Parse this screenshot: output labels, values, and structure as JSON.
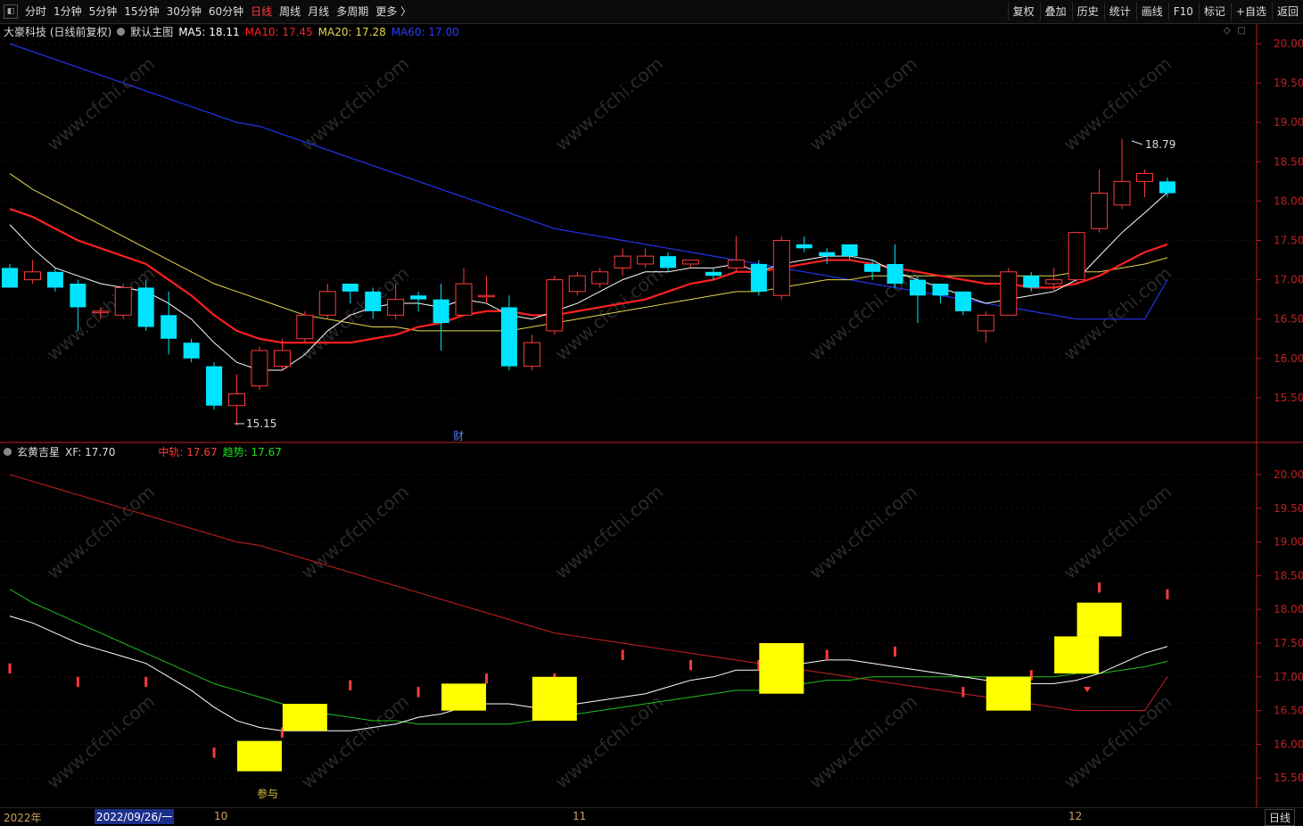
{
  "toolbar": {
    "periods": [
      "分时",
      "1分钟",
      "5分钟",
      "15分钟",
      "30分钟",
      "60分钟",
      "日线",
      "周线",
      "月线",
      "多周期",
      "更多 〉"
    ],
    "active_index": 6,
    "right_buttons": [
      "复权",
      "叠加",
      "历史",
      "统计",
      "画线",
      "F10",
      "标记",
      "+自选",
      "返回"
    ]
  },
  "main_legend": {
    "stock": "大豪科技 (日线前复权)",
    "indicator": "默认主图",
    "ma5": "MA5: 18.11",
    "ma10": "MA10: 17.45",
    "ma20": "MA20: 17.28",
    "ma60": "MA60: 17.00"
  },
  "sub_legend": {
    "name": "玄黄吉星",
    "xf": "XF: 17.70",
    "zg": "中轨: 17.67",
    "qs": "趋势: 17.67"
  },
  "annotations": {
    "high": "18.79",
    "low": "15.15",
    "cai": "财",
    "canyu": "参与"
  },
  "watermark": "www.cfchi.com",
  "main_axis": [
    "20.00",
    "19.50",
    "19.00",
    "18.50",
    "18.00",
    "17.50",
    "17.00",
    "16.50",
    "16.00",
    "15.50"
  ],
  "sub_axis": [
    "20.00",
    "19.50",
    "19.00",
    "18.50",
    "18.00",
    "17.50",
    "17.00",
    "16.50",
    "16.00",
    "15.50"
  ],
  "datebar": {
    "year": "2022年",
    "cursor": "2022/09/26/一",
    "m10": "10",
    "m11": "11",
    "m12": "12",
    "period": "日线"
  },
  "colors": {
    "up": "#ff3b3b",
    "down": "#00e5ff",
    "ma5": "#ffffff",
    "ma10": "#ff2020",
    "ma20": "#e6d64a",
    "ma60": "#2233ee",
    "axis": "#c02020",
    "signal": "#ffff00",
    "trend": "#1fbf1f"
  },
  "chart_data": {
    "type": "candlestick",
    "price_range": [
      15.0,
      20.2
    ],
    "candles": [
      [
        17.15,
        16.9,
        17.2,
        16.9
      ],
      [
        17.0,
        17.1,
        17.25,
        16.95
      ],
      [
        17.1,
        16.9,
        17.15,
        16.85
      ],
      [
        16.95,
        16.65,
        17.0,
        16.35
      ],
      [
        16.6,
        16.6,
        16.65,
        16.5
      ],
      [
        16.55,
        16.9,
        16.95,
        16.5
      ],
      [
        16.9,
        16.4,
        17.0,
        16.35
      ],
      [
        16.55,
        16.25,
        16.85,
        16.05
      ],
      [
        16.2,
        16.0,
        16.25,
        15.95
      ],
      [
        15.9,
        15.4,
        15.95,
        15.35
      ],
      [
        15.4,
        15.55,
        15.8,
        15.15
      ],
      [
        15.65,
        16.1,
        16.15,
        15.6
      ],
      [
        15.9,
        16.1,
        16.25,
        15.85
      ],
      [
        16.25,
        16.55,
        16.6,
        16.2
      ],
      [
        16.55,
        16.85,
        16.95,
        16.5
      ],
      [
        16.95,
        16.85,
        16.95,
        16.7
      ],
      [
        16.85,
        16.6,
        16.9,
        16.5
      ],
      [
        16.55,
        16.75,
        16.95,
        16.5
      ],
      [
        16.8,
        16.75,
        16.85,
        16.6
      ],
      [
        16.75,
        16.45,
        16.95,
        16.1
      ],
      [
        16.55,
        16.95,
        17.15,
        16.55
      ],
      [
        16.8,
        16.8,
        17.05,
        16.7
      ],
      [
        16.65,
        15.9,
        16.8,
        15.85
      ],
      [
        15.9,
        16.2,
        16.3,
        15.85
      ],
      [
        16.35,
        17.0,
        17.05,
        16.3
      ],
      [
        16.85,
        17.05,
        17.1,
        16.8
      ],
      [
        16.95,
        17.1,
        17.15,
        16.9
      ],
      [
        17.15,
        17.3,
        17.4,
        17.05
      ],
      [
        17.2,
        17.3,
        17.4,
        17.15
      ],
      [
        17.3,
        17.15,
        17.35,
        17.1
      ],
      [
        17.2,
        17.25,
        17.25,
        17.15
      ],
      [
        17.1,
        17.05,
        17.15,
        17.0
      ],
      [
        17.15,
        17.25,
        17.55,
        17.1
      ],
      [
        17.2,
        16.85,
        17.25,
        16.8
      ],
      [
        16.8,
        17.5,
        17.55,
        16.75
      ],
      [
        17.45,
        17.4,
        17.55,
        17.35
      ],
      [
        17.35,
        17.3,
        17.4,
        17.2
      ],
      [
        17.45,
        17.3,
        17.45,
        17.25
      ],
      [
        17.2,
        17.1,
        17.25,
        17.0
      ],
      [
        17.2,
        16.95,
        17.45,
        16.9
      ],
      [
        17.0,
        16.8,
        17.05,
        16.45
      ],
      [
        16.95,
        16.8,
        16.95,
        16.7
      ],
      [
        16.85,
        16.6,
        16.85,
        16.55
      ],
      [
        16.35,
        16.55,
        16.6,
        16.2
      ],
      [
        16.55,
        17.1,
        17.15,
        16.55
      ],
      [
        17.05,
        16.9,
        17.1,
        16.85
      ],
      [
        16.95,
        17.0,
        17.15,
        16.85
      ],
      [
        17.0,
        17.6,
        17.6,
        16.95
      ],
      [
        17.65,
        18.1,
        18.4,
        17.6
      ],
      [
        17.95,
        18.25,
        18.79,
        17.9
      ],
      [
        18.25,
        18.35,
        18.4,
        18.05
      ],
      [
        18.25,
        18.1,
        18.3,
        18.05
      ]
    ],
    "ma5": [
      17.7,
      17.4,
      17.15,
      17.05,
      16.95,
      16.9,
      16.85,
      16.7,
      16.5,
      16.2,
      15.95,
      15.85,
      15.85,
      16.05,
      16.35,
      16.55,
      16.65,
      16.7,
      16.7,
      16.65,
      16.75,
      16.7,
      16.55,
      16.5,
      16.6,
      16.7,
      16.85,
      17.0,
      17.1,
      17.1,
      17.15,
      17.15,
      17.2,
      17.1,
      17.2,
      17.25,
      17.3,
      17.3,
      17.25,
      17.1,
      17.0,
      16.9,
      16.8,
      16.7,
      16.75,
      16.8,
      16.85,
      17.0,
      17.3,
      17.6,
      17.85,
      18.11
    ],
    "ma10": [
      17.9,
      17.8,
      17.65,
      17.5,
      17.4,
      17.3,
      17.2,
      17.0,
      16.8,
      16.55,
      16.35,
      16.25,
      16.2,
      16.2,
      16.2,
      16.2,
      16.25,
      16.3,
      16.4,
      16.45,
      16.55,
      16.6,
      16.6,
      16.55,
      16.55,
      16.6,
      16.65,
      16.7,
      16.75,
      16.85,
      16.95,
      17.0,
      17.1,
      17.1,
      17.15,
      17.2,
      17.25,
      17.25,
      17.2,
      17.15,
      17.1,
      17.05,
      17.0,
      16.95,
      16.95,
      16.9,
      16.9,
      16.95,
      17.05,
      17.2,
      17.35,
      17.45
    ],
    "ma20": [
      18.35,
      18.15,
      18.0,
      17.85,
      17.7,
      17.55,
      17.4,
      17.25,
      17.1,
      16.95,
      16.85,
      16.75,
      16.65,
      16.55,
      16.5,
      16.45,
      16.4,
      16.4,
      16.35,
      16.35,
      16.35,
      16.35,
      16.35,
      16.4,
      16.45,
      16.5,
      16.55,
      16.6,
      16.65,
      16.7,
      16.75,
      16.8,
      16.85,
      16.85,
      16.9,
      16.95,
      17.0,
      17.0,
      17.05,
      17.05,
      17.05,
      17.05,
      17.05,
      17.05,
      17.05,
      17.05,
      17.05,
      17.1,
      17.1,
      17.15,
      17.2,
      17.28
    ],
    "ma60": [
      20.0,
      19.9,
      19.8,
      19.7,
      19.6,
      19.5,
      19.4,
      19.3,
      19.2,
      19.1,
      19.0,
      18.95,
      18.85,
      18.75,
      18.65,
      18.55,
      18.45,
      18.35,
      18.25,
      18.15,
      18.05,
      17.95,
      17.85,
      17.75,
      17.65,
      17.6,
      17.55,
      17.5,
      17.45,
      17.4,
      17.35,
      17.3,
      17.25,
      17.2,
      17.15,
      17.1,
      17.05,
      17.0,
      16.95,
      16.9,
      16.85,
      16.8,
      16.75,
      16.7,
      16.65,
      16.6,
      16.55,
      16.5,
      16.5,
      16.5,
      16.5,
      17.0
    ]
  }
}
